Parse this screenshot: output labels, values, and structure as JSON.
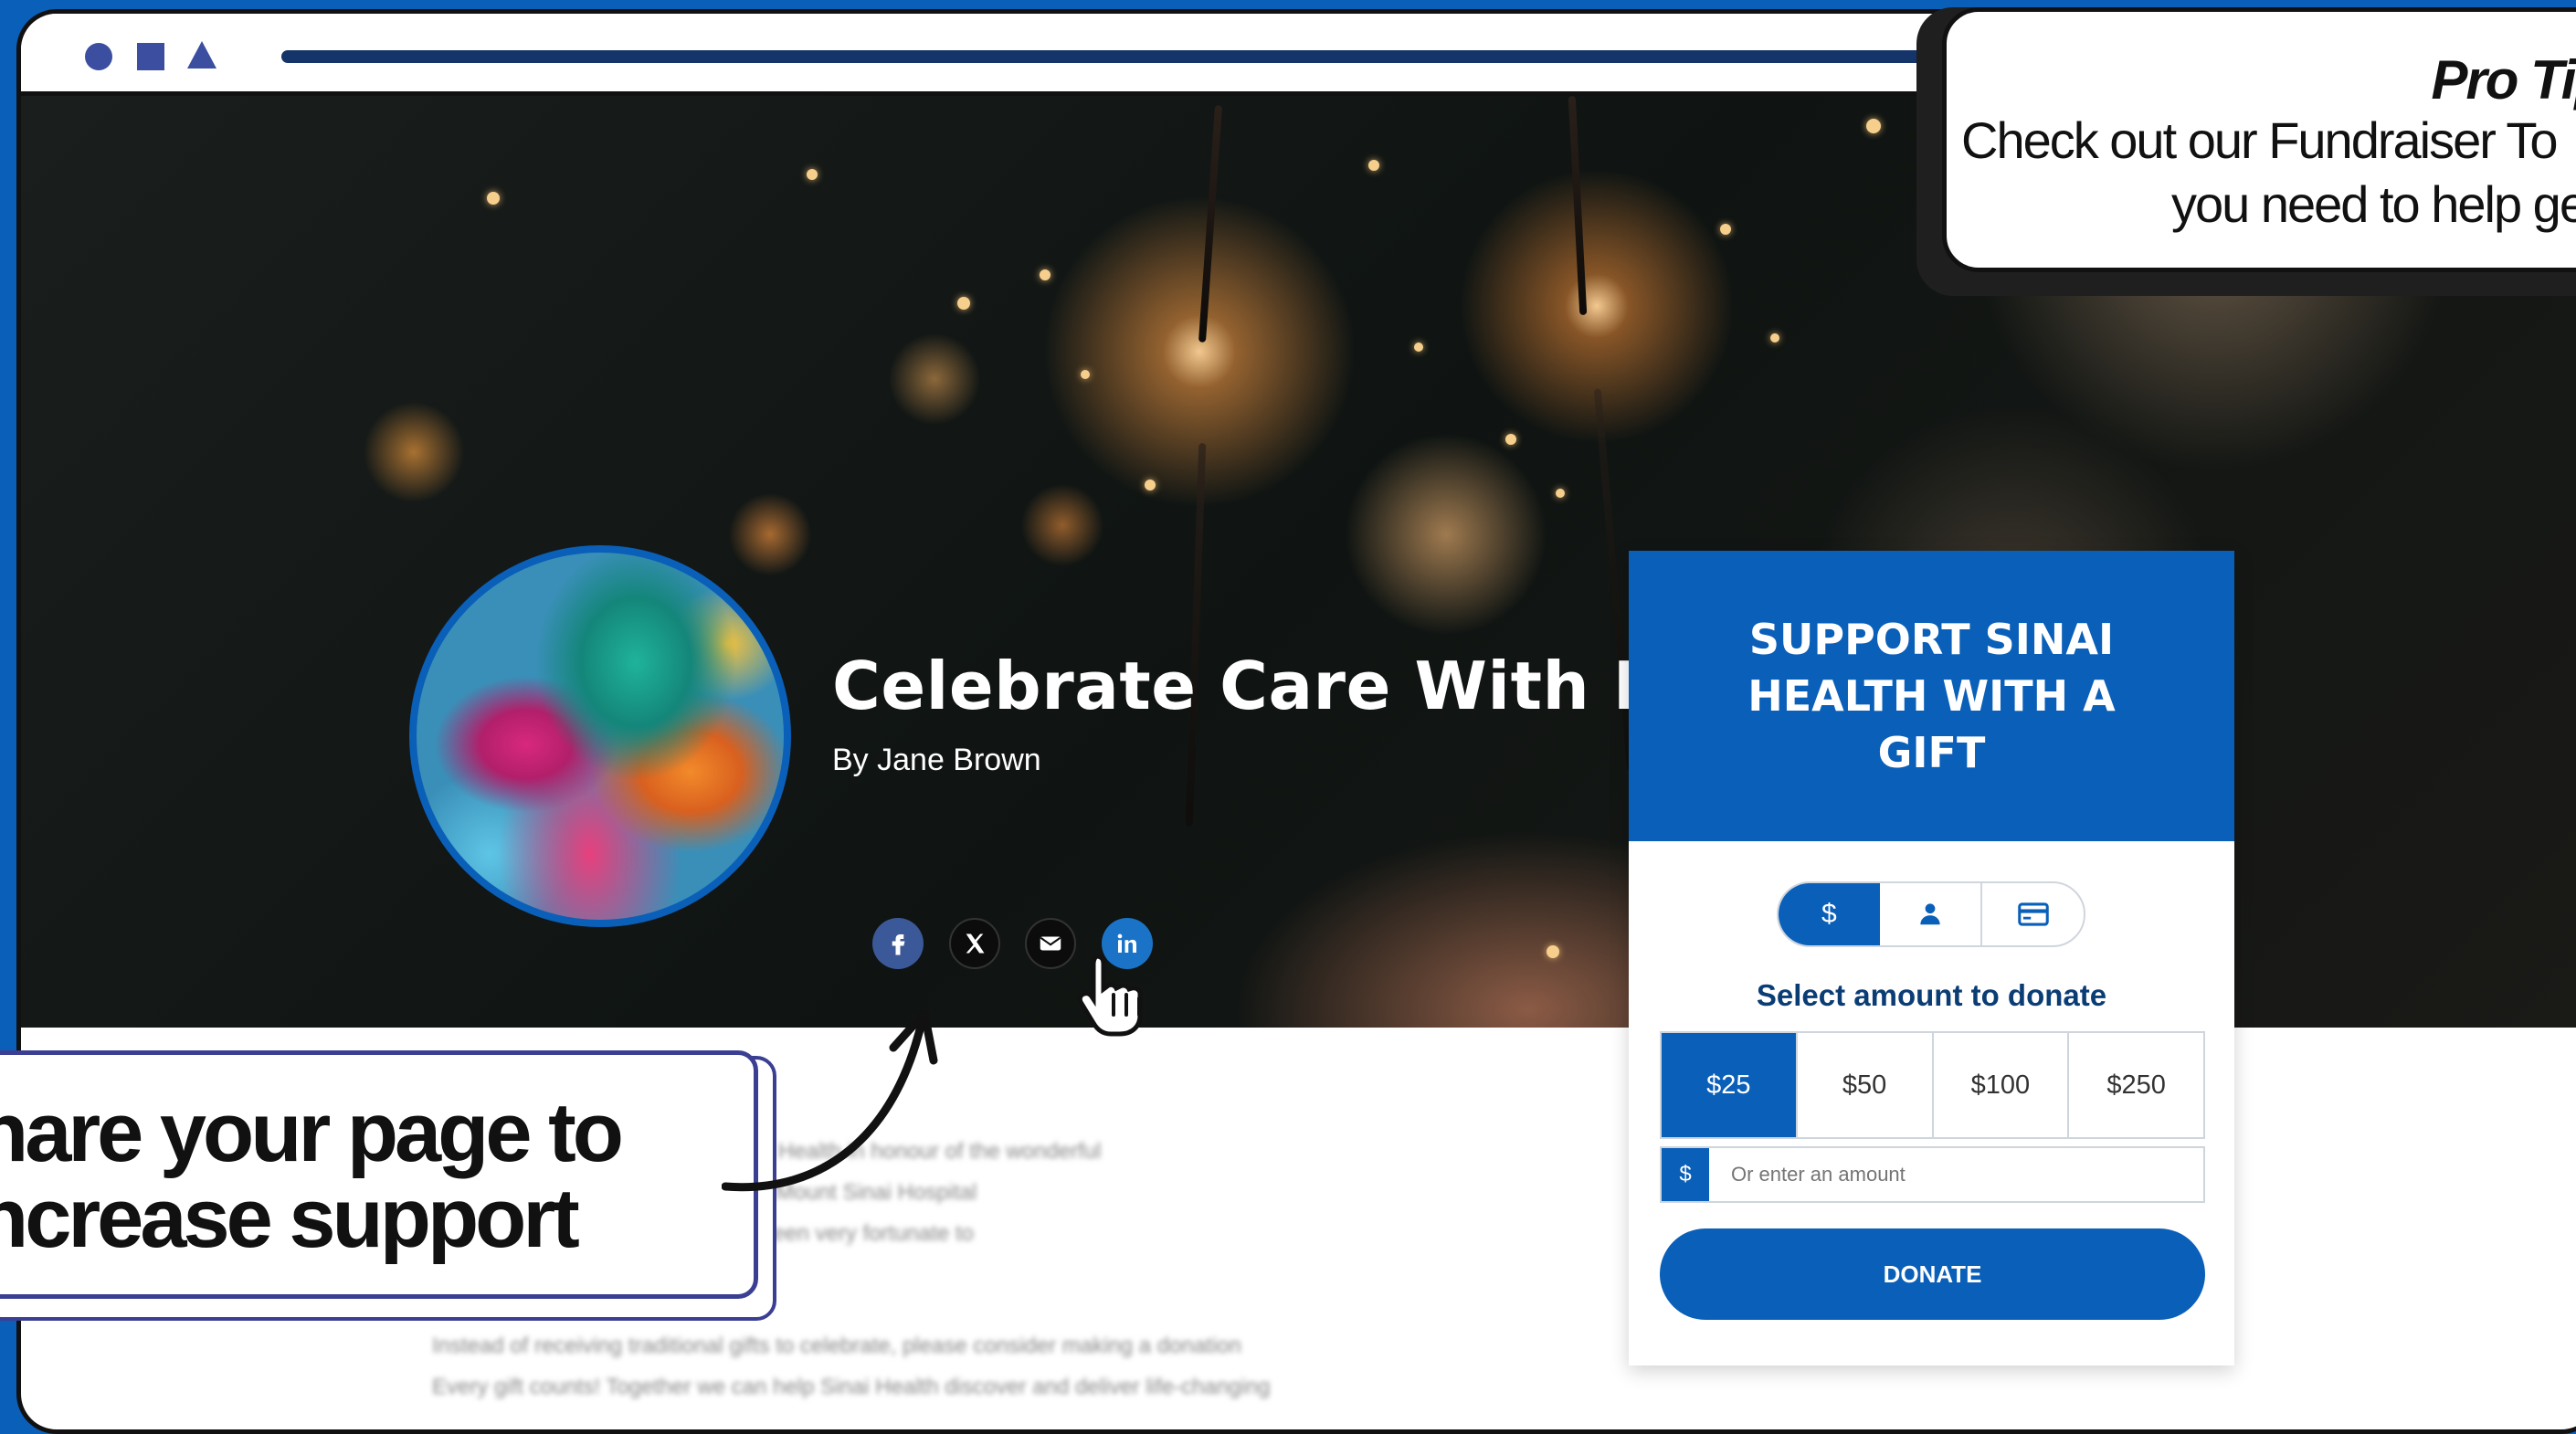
{
  "browser": {
    "window_controls": [
      "circle-shape",
      "square-shape",
      "triangle-shape"
    ]
  },
  "hero": {
    "title": "Celebrate Care With Me",
    "byline": "By Jane Brown",
    "share_icons": [
      "facebook-icon",
      "x-icon",
      "email-icon",
      "linkedin-icon"
    ]
  },
  "donation": {
    "heading": "SUPPORT SINAI HEALTH WITH A GIFT",
    "tabs": [
      {
        "icon": "dollar-icon",
        "label": "$"
      },
      {
        "icon": "person-icon",
        "label": ""
      },
      {
        "icon": "credit-card-icon",
        "label": ""
      }
    ],
    "select_label": "Select amount to donate",
    "amounts": [
      "$25",
      "$50",
      "$100",
      "$250"
    ],
    "selected_amount": "$25",
    "currency_symbol": "$",
    "custom_placeholder": "Or enter an amount",
    "donate_label": "DONATE",
    "accent_color": "#0a5fb8"
  },
  "pro_tip": {
    "title": "Pro Tip:",
    "line1": "Check out our Fundraiser To",
    "line2": "you need to help ge"
  },
  "callout": {
    "line1": "hare your page to",
    "line2": "ncrease support"
  }
}
